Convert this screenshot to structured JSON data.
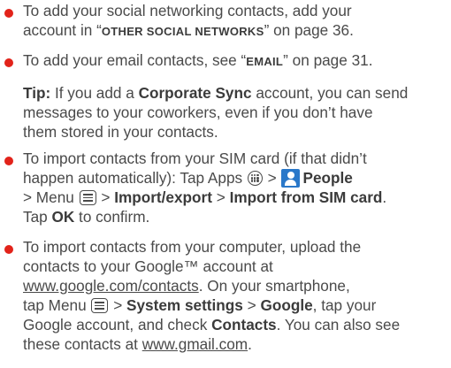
{
  "colors": {
    "bullet": "#e2231a",
    "people_icon": "#2a78c9",
    "text": "#4a4a4a"
  },
  "icons": {
    "apps": "apps-icon",
    "people": "people-icon",
    "menu": "menu-key-icon"
  },
  "b1": {
    "l1": "To add your social networking contacts, add your",
    "l2_a": "account in “",
    "l2_caps": "OTHER SOCIAL NETWORKS",
    "l2_b": "” on page 36."
  },
  "b2": {
    "a": "To add your email contacts, see “",
    "caps": "EMAIL",
    "b": "” on page 31."
  },
  "tip": {
    "label": "Tip:",
    "l1_a": " If you add a ",
    "l1_bold": "Corporate Sync",
    "l1_b": " account, you can send",
    "l2": "messages to your coworkers, even if you don’t have",
    "l3": "them stored in your contacts."
  },
  "b3": {
    "l1": "To import contacts from your SIM card (if that didn’t",
    "l2_a": "happen automatically): Tap Apps ",
    "l2_b": " > ",
    "people": "People",
    "l3_a": "> Menu ",
    "l3_b": " > ",
    "import_export": "Import/export",
    "l3_c": " > ",
    "import_sim": "Import from SIM card",
    "l3_d": ".",
    "l4_a": "Tap ",
    "ok": "OK",
    "l4_b": " to confirm."
  },
  "b4": {
    "l1": "To import contacts from your computer, upload the",
    "l2": "contacts to your Google™ account at",
    "link1": "www.google.com/contacts",
    "l3_b": ". On your smartphone,",
    "l4_a": "tap Menu ",
    "l4_b": " > ",
    "system_settings": "System settings",
    "l4_c": " > ",
    "google": "Google",
    "l4_d": ", tap your",
    "l5": "Google account, and check ",
    "contacts": "Contacts",
    "l5_b": ". You can also see",
    "l6_a": "these contacts at ",
    "link2": "www.gmail.com",
    "l6_b": "."
  }
}
